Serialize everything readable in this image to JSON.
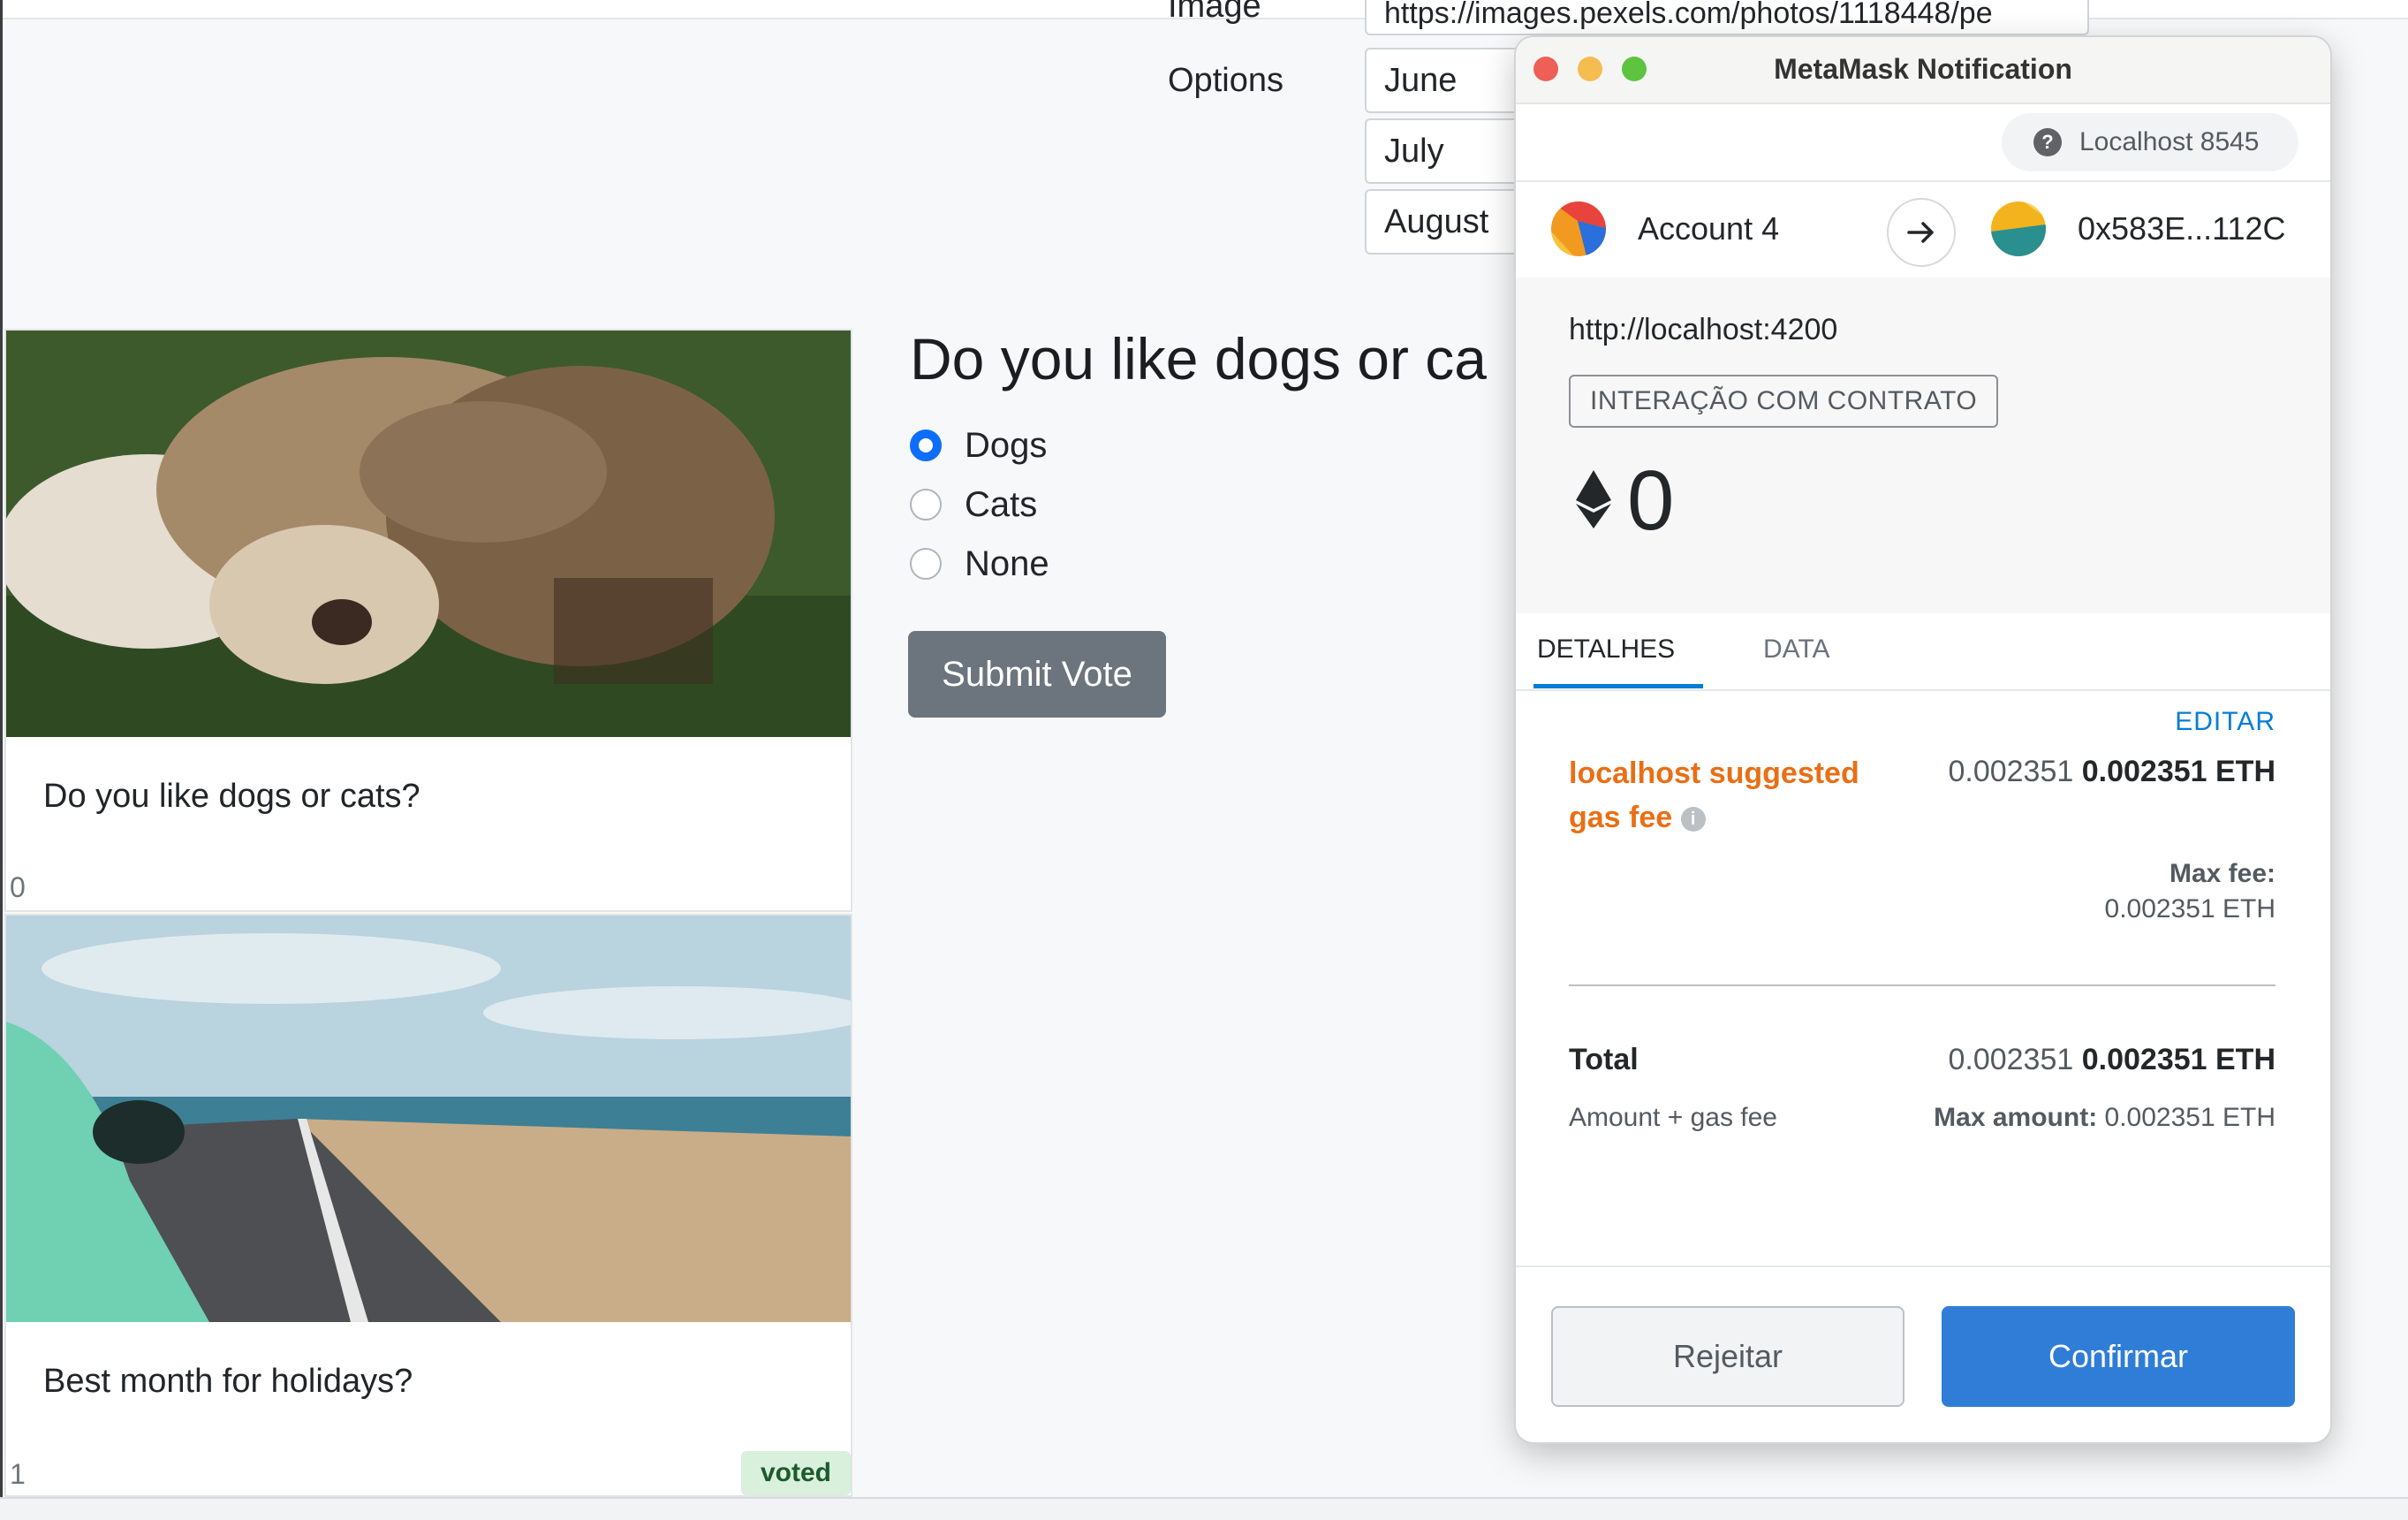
{
  "page": {
    "image_label_partial": "Image",
    "image_url_partial": "https://images.pexels.com/photos/1118448/pe",
    "options_label": "Options",
    "options": [
      "June",
      "July",
      "August"
    ]
  },
  "cards": [
    {
      "title": "Do you like dogs or cats?",
      "count": "0"
    },
    {
      "title": "Best month for holidays?",
      "count": "1",
      "badge": "voted"
    }
  ],
  "poll": {
    "question": "Do you like dogs or ca",
    "options": [
      {
        "label": "Dogs",
        "checked": true
      },
      {
        "label": "Cats",
        "checked": false
      },
      {
        "label": "None",
        "checked": false
      }
    ],
    "submit_label": "Submit Vote"
  },
  "metamask": {
    "window_title": "MetaMask Notification",
    "network": "Localhost 8545",
    "from_account": "Account 4",
    "to_address": "0x583E...112C",
    "origin": "http://localhost:4200",
    "tx_type": "INTERAÇÃO COM CONTRATO",
    "amount": "0",
    "tabs": [
      "DETALHES",
      "DATA"
    ],
    "edit_label": "EDITAR",
    "gas_label": "localhost suggested gas fee",
    "gas_fee_secondary": "0.002351",
    "gas_fee_primary": "0.002351 ETH",
    "max_fee_label": "Max fee:",
    "max_fee_value": "0.002351 ETH",
    "total_label": "Total",
    "total_secondary": "0.002351",
    "total_primary": "0.002351 ETH",
    "total_sub_label": "Amount + gas fee",
    "max_amount_label": "Max amount:",
    "max_amount_value": "0.002351 ETH",
    "reject_label": "Rejeitar",
    "confirm_label": "Confirmar"
  },
  "colors": {
    "primary_blue": "#037dd6",
    "confirm_button": "#2f7dd6",
    "gas_orange": "#e86f16",
    "submit_gray": "#6c757d",
    "radio_checked": "#0d6efd"
  }
}
